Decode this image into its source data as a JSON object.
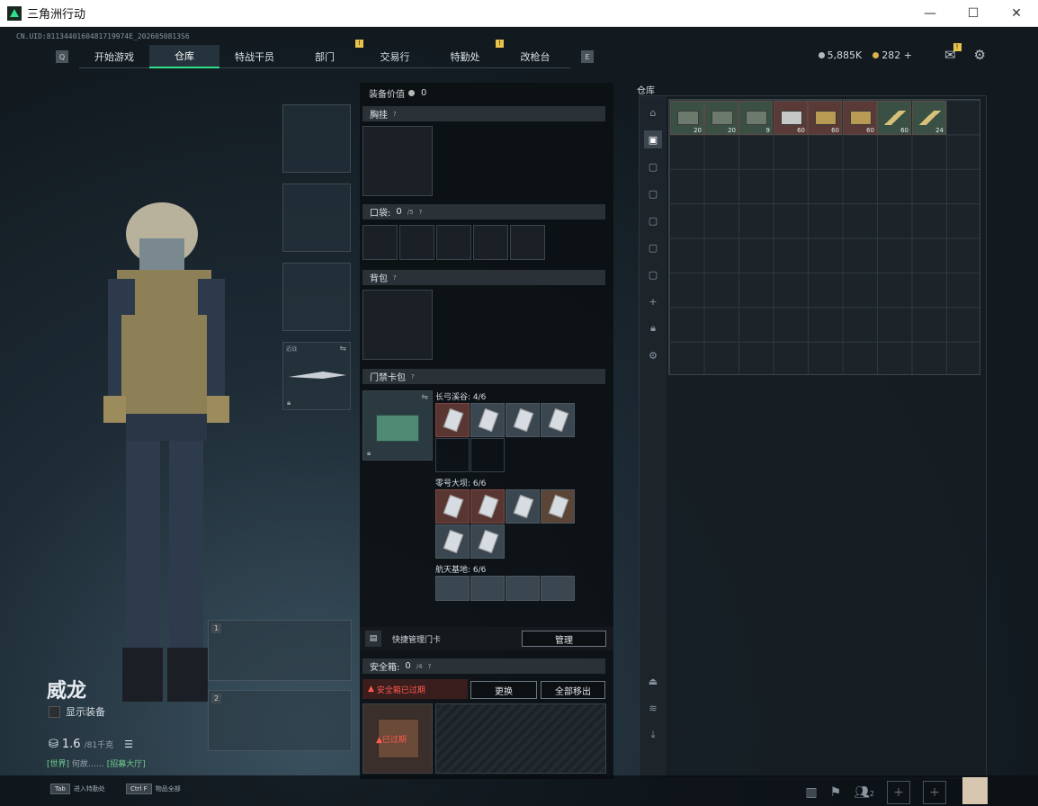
{
  "window": {
    "title": "三角洲行动",
    "minimize": "—",
    "maximize": "☐",
    "close": "✕"
  },
  "uid": "CN.UID:8113440160481719974E_2026050813S6",
  "nav": {
    "left_key": "Q",
    "right_key": "E",
    "tabs": [
      {
        "label": "开始游戏",
        "badge": ""
      },
      {
        "label": "仓库",
        "badge": ""
      },
      {
        "label": "特战干员",
        "badge": ""
      },
      {
        "label": "部门",
        "badge": "!"
      },
      {
        "label": "交易行",
        "badge": ""
      },
      {
        "label": "特勤处",
        "badge": "!"
      },
      {
        "label": "改枪台",
        "badge": ""
      }
    ]
  },
  "currency": {
    "silver": "5,885K",
    "gold": "282",
    "plus": "+"
  },
  "character": {
    "name": "威龙",
    "show_equipment": "显示装备",
    "weight": "1.6",
    "weight_max": "/81千克",
    "chat_channel": "[世界]",
    "chat_text": "何故……",
    "chat_link": "[招募大厅]"
  },
  "side_slots": {
    "knife_label": "近战",
    "slot1": "1",
    "slot2": "2"
  },
  "equip": {
    "header": "装备价值",
    "value": "0",
    "chest": "胸挂",
    "pocket": "口袋:",
    "pocket_count": "0",
    "pocket_max": "/5",
    "backpack": "背包",
    "keycard_bag": "门禁卡包",
    "help": "?",
    "groups": [
      {
        "name": "长弓溪谷:",
        "count": "4/6"
      },
      {
        "name": "零号大坝:",
        "count": "6/6"
      },
      {
        "name": "航天基地:",
        "count": "6/6"
      }
    ],
    "quick_manage": "快捷管理门卡",
    "manage_btn": "管理",
    "safe_box": "安全箱:",
    "safe_count": "0",
    "safe_max": "/4",
    "safe_expired": "安全箱已过期",
    "replace_btn": "更换",
    "move_all_btn": "全部移出",
    "expired_tag": "已过期"
  },
  "storage": {
    "title": "仓库",
    "items": [
      {
        "qty": "20",
        "kind": "ammo"
      },
      {
        "qty": "20",
        "kind": "ammo"
      },
      {
        "qty": "9",
        "kind": "ammo"
      },
      {
        "qty": "60",
        "kind": "box"
      },
      {
        "qty": "60",
        "kind": "gold"
      },
      {
        "qty": "60",
        "kind": "gold"
      },
      {
        "qty": "60",
        "kind": "bullet"
      },
      {
        "qty": "24",
        "kind": "bullet"
      }
    ]
  },
  "bottombar": {
    "hint1_key": "Tab",
    "hint1": "进入特勤处",
    "hint2_key": "Ctrl F",
    "hint2": "物品全部",
    "friends": "2"
  }
}
